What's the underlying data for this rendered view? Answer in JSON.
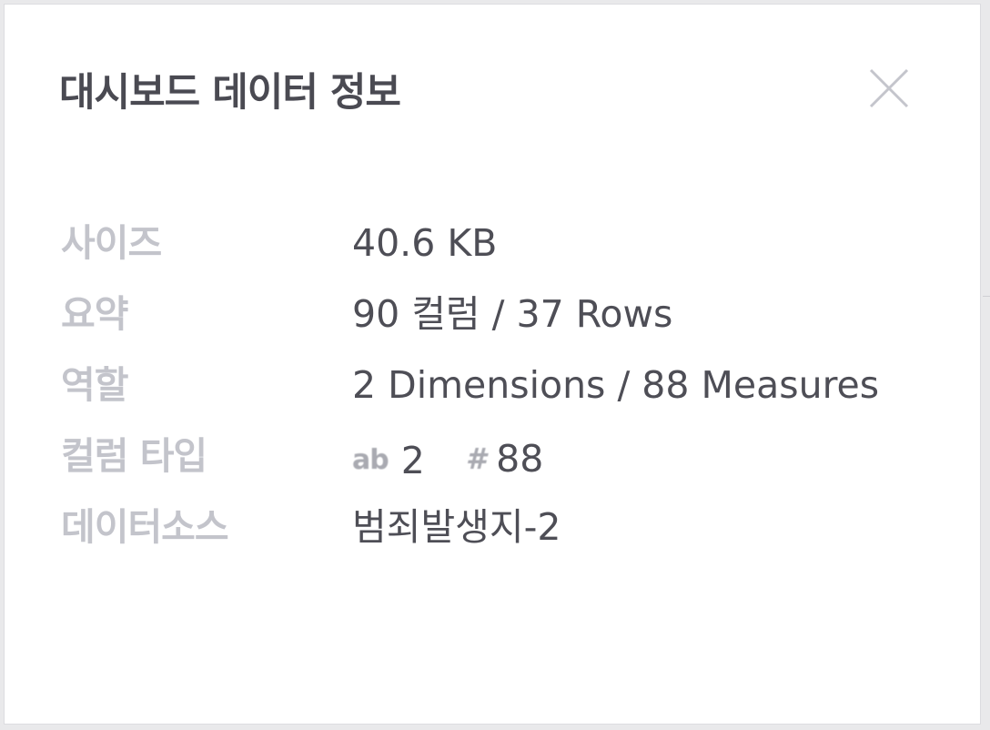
{
  "dialog": {
    "title": "대시보드 데이터 정보",
    "close_icon": "close-icon"
  },
  "info": {
    "size_label": "사이즈",
    "size_value": "40.6 KB",
    "summary_label": "요약",
    "summary_value": "90 컬럼 / 37 Rows",
    "role_label": "역할",
    "role_value": "2 Dimensions / 88 Measures",
    "column_type_label": "컬럼 타입",
    "column_types": {
      "text_icon": "ab",
      "text_count": "2",
      "number_icon": "#",
      "number_count": "88"
    },
    "datasource_label": "데이터소스",
    "datasource_value": "범죄발생지-2"
  },
  "colors": {
    "title": "#4a4a52",
    "label": "#c3c4cb",
    "value": "#4e4e56",
    "background": "#ffffff"
  }
}
